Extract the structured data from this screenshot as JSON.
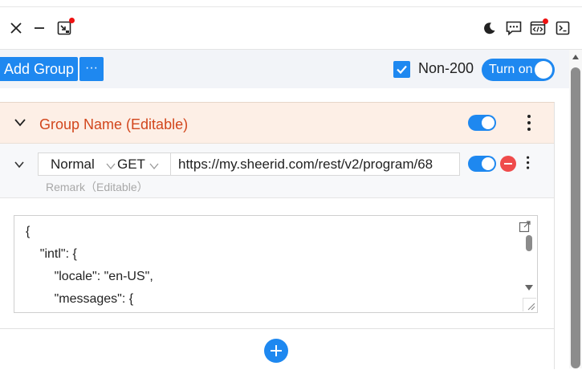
{
  "titlebar": {
    "close_icon": "close-icon",
    "minimize_icon": "minimize-icon",
    "popout_icon": "popout-icon",
    "theme_icon": "moon-icon",
    "feedback_icon": "chat-icon",
    "devtools_icon": "code-icon",
    "terminal_icon": "terminal-icon",
    "badge_color": "#e11111"
  },
  "toolbar": {
    "add_group_label": "Add Group",
    "more_label": "···",
    "non200_label": "Non-200",
    "non200_checked": true,
    "turn_on_label": "Turn on"
  },
  "group": {
    "name": "Group Name (Editable)",
    "enabled": true
  },
  "rule": {
    "mode": "Normal",
    "method": "GET",
    "url": "https://my.sheerid.com/rest/v2/program/68",
    "remark_placeholder": "Remark（Editable）",
    "enabled": true
  },
  "editor": {
    "lines": [
      "{",
      "    \"intl\": {",
      "        \"locale\": \"en-US\",",
      "        \"messages\": {"
    ]
  },
  "colors": {
    "accent": "#1e88f0",
    "group_bg": "#fdefe6",
    "group_name": "#d2461c",
    "danger": "#ef4b4b"
  }
}
